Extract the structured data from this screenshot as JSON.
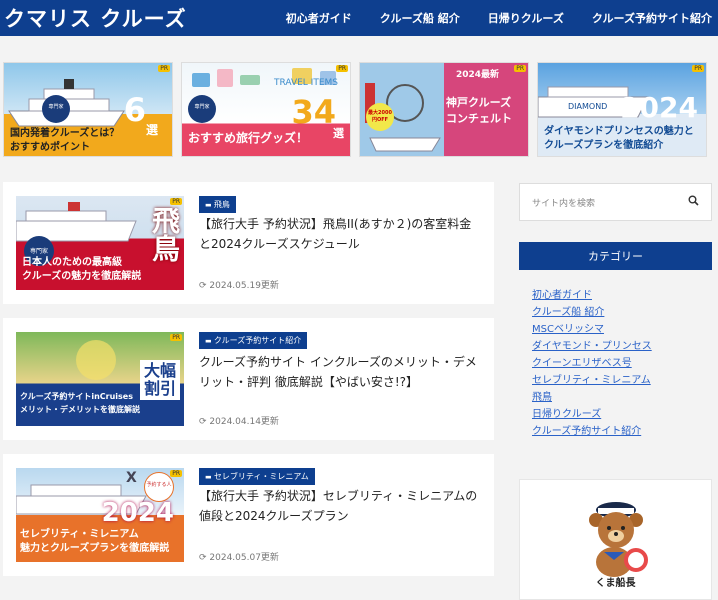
{
  "header": {
    "logo": "クマリス クルーズ",
    "nav": [
      "初心者ガイド",
      "クルーズ船 紹介",
      "日帰りクルーズ",
      "クルーズ予約サイト紹介"
    ]
  },
  "banners": [
    {
      "text": "国内発着クルーズとは？\nおすすめポイント",
      "number": "6",
      "suffix": "選",
      "colors": [
        "#8fc7ea",
        "#f2a91c"
      ]
    },
    {
      "text": "おすすめ旅行グッズ！",
      "number": "34",
      "suffix": "選",
      "colors": [
        "#f0f6fa",
        "#e84565"
      ]
    },
    {
      "text": "神戸クルーズ\nコンチェルト",
      "badge": "2024最新",
      "colors": [
        "#d6467c",
        "#7b2456"
      ]
    },
    {
      "text": "ダイヤモンドプリンセスの魅力と\nクルーズプランを徹底紹介",
      "number": "2024",
      "colors": [
        "#5aa2e0",
        "#124b94"
      ]
    }
  ],
  "posts": [
    {
      "category": "飛鳥",
      "title": "【旅行大手 予約状況】飛鳥II(あすか２)の客室料金と2024クルーズスケジュール",
      "date": "2024.05.19更新",
      "thumb_text": "日本人のための最高級\nクルーズの魅力を徹底解説",
      "thumb_big": "飛鳥"
    },
    {
      "category": "クルーズ予約サイト紹介",
      "title": "クルーズ予約サイト インクルーズのメリット・デメリット・評判 徹底解説【やばい安さ!?】",
      "date": "2024.04.14更新",
      "thumb_text": "クルーズ予約サイトinCruises\nメリット・デメリットを徹底解説",
      "thumb_big": "大幅\n割引"
    },
    {
      "category": "セレブリティ・ミレニアム",
      "title": "【旅行大手 予約状況】セレブリティ・ミレニアムの値段と2024クルーズプラン",
      "date": "2024.05.07更新",
      "thumb_text": "セレブリティ・ミレニアム\n魅力とクルーズプランを徹底解説",
      "thumb_big": "2024"
    }
  ],
  "sidebar": {
    "search_placeholder": "サイト内を検索",
    "category_heading": "カテゴリー",
    "categories": [
      "初心者ガイド",
      "クルーズ船 紹介",
      "MSCベリッシマ",
      "ダイヤモンド・プリンセス",
      "クイーンエリザベス号",
      "セレブリティ・ミレニアム",
      "飛鳥",
      "日帰りクルーズ",
      "クルーズ予約サイト紹介"
    ],
    "profile_name": "くま船長"
  },
  "colors": {
    "brand": "#0e3f8f",
    "link": "#2a62c8"
  }
}
